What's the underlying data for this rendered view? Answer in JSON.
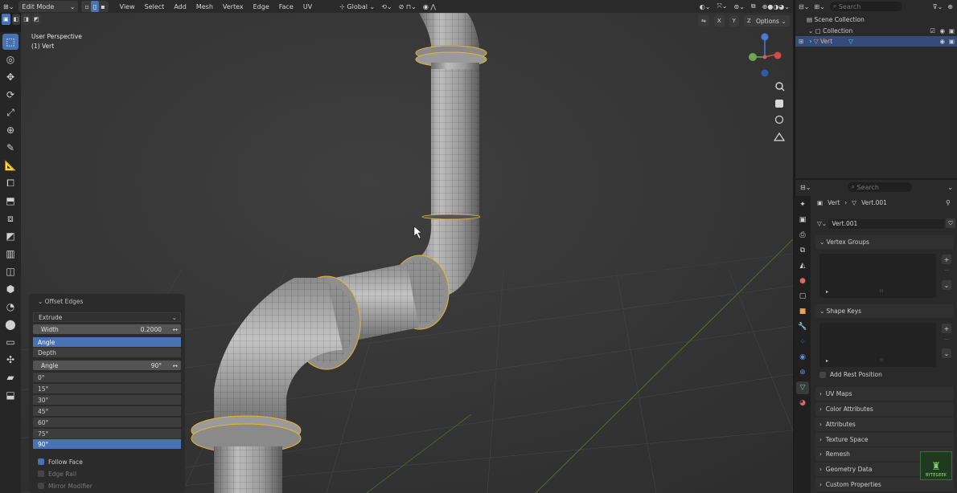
{
  "header": {
    "mode": "Edit Mode",
    "menus": [
      "View",
      "Select",
      "Add",
      "Mesh",
      "Vertex",
      "Edge",
      "Face",
      "UV"
    ],
    "transform_orientation": "Global",
    "options_label": "Options",
    "axes": [
      "X",
      "Y",
      "Z"
    ]
  },
  "viewport": {
    "perspective_label": "User Perspective",
    "object_label": "(1) Vert"
  },
  "operator_panel": {
    "title": "Offset Edges",
    "geometry_mode": "Extrude",
    "width_label": "Width",
    "width_value": "0.2000",
    "mode_options": [
      "Angle",
      "Depth"
    ],
    "angle_label": "Angle",
    "angle_value": "90°",
    "angle_presets": [
      "0°",
      "15°",
      "30°",
      "45°",
      "60°",
      "75°",
      "90°"
    ],
    "follow_face_label": "Follow Face",
    "edge_rail_label": "Edge Rail",
    "mirror_modifier_label": "Mirror Modifier"
  },
  "outliner": {
    "search_placeholder": "Search",
    "scene_collection": "Scene Collection",
    "collection": "Collection",
    "object": "Vert"
  },
  "properties": {
    "search_placeholder": "Search",
    "breadcrumb_object": "Vert",
    "breadcrumb_data": "Vert.001",
    "mesh_name": "Vert.001",
    "sections": {
      "vertex_groups": "Vertex Groups",
      "shape_keys": "Shape Keys",
      "add_rest_position": "Add Rest Position",
      "uv_maps": "UV Maps",
      "color_attributes": "Color Attributes",
      "attributes": "Attributes",
      "texture_space": "Texture Space",
      "remesh": "Remesh",
      "geometry_data": "Geometry Data",
      "custom_properties": "Custom Properties"
    }
  },
  "watermark_text": "BYTEGEEK",
  "colors": {
    "accent": "#4772b3",
    "selected_edge": "#e8b52a",
    "grid_x": "#8a3a3a",
    "grid_y": "#5d7a2a"
  }
}
